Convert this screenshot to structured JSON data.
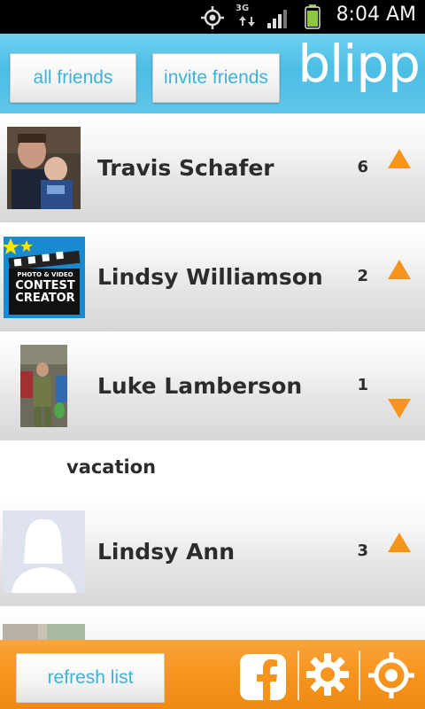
{
  "status_bar": {
    "time": "8:04 AM",
    "network": "3G"
  },
  "header": {
    "all_friends_label": "all friends",
    "invite_friends_label": "invite friends",
    "logo_text": "blipp"
  },
  "friends": [
    {
      "name": "Travis Schafer",
      "count": "6",
      "trend": "up"
    },
    {
      "name": "Lindsy Williamson",
      "count": "2",
      "trend": "up",
      "avatar_text": [
        "PHOTO & VIDEO",
        "CONTEST",
        "CREATOR"
      ]
    },
    {
      "name": "Luke Lamberson",
      "count": "1",
      "trend": "down"
    },
    {
      "name": "Lindsy Ann",
      "count": "3",
      "trend": "up"
    }
  ],
  "expanded_item": {
    "text": "vacation"
  },
  "footer": {
    "refresh_label": "refresh list"
  },
  "colors": {
    "accent": "#f7941d",
    "header_blue": "#4bbde5",
    "button_text": "#3ab3dd"
  }
}
